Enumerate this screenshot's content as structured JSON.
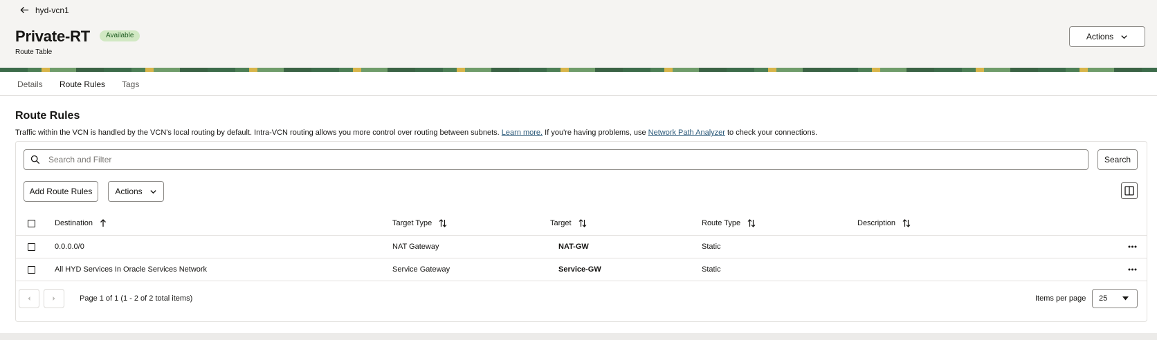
{
  "header": {
    "back_label": "hyd-vcn1",
    "title": "Private-RT",
    "status": "Available",
    "subtitle": "Route Table",
    "actions_label": "Actions"
  },
  "tabs": [
    {
      "label": "Details",
      "active": false
    },
    {
      "label": "Route Rules",
      "active": true
    },
    {
      "label": "Tags",
      "active": false
    }
  ],
  "section": {
    "title": "Route Rules",
    "desc_part1": "Traffic within the VCN is handled by the VCN's local routing by default. Intra-VCN routing allows you more control over routing between subnets.",
    "learn_more": "Learn more.",
    "desc_part2": "If you're having problems, use",
    "npa_link": "Network Path Analyzer",
    "desc_part3": "to check your connections."
  },
  "toolbar": {
    "search_placeholder": "Search and Filter",
    "search_label": "Search",
    "add_label": "Add Route Rules",
    "actions_label": "Actions"
  },
  "table": {
    "columns": [
      "Destination",
      "Target Type",
      "Target",
      "Route Type",
      "Description"
    ],
    "rows": [
      {
        "destination": "0.0.0.0/0",
        "target_type": "NAT Gateway",
        "target": "NAT-GW",
        "route_type": "Static",
        "description": ""
      },
      {
        "destination": "All HYD Services In Oracle Services Network",
        "target_type": "Service Gateway",
        "target": "Service-GW",
        "route_type": "Static",
        "description": ""
      }
    ]
  },
  "pagination": {
    "summary": "Page 1 of 1 (1 - 2 of 2 total items)",
    "items_per_page_label": "Items per page",
    "items_per_page": "25"
  },
  "colors": {
    "badge_bg": "#d1e8c3",
    "badge_text": "#1d5b20",
    "link": "#2c5a7a"
  }
}
